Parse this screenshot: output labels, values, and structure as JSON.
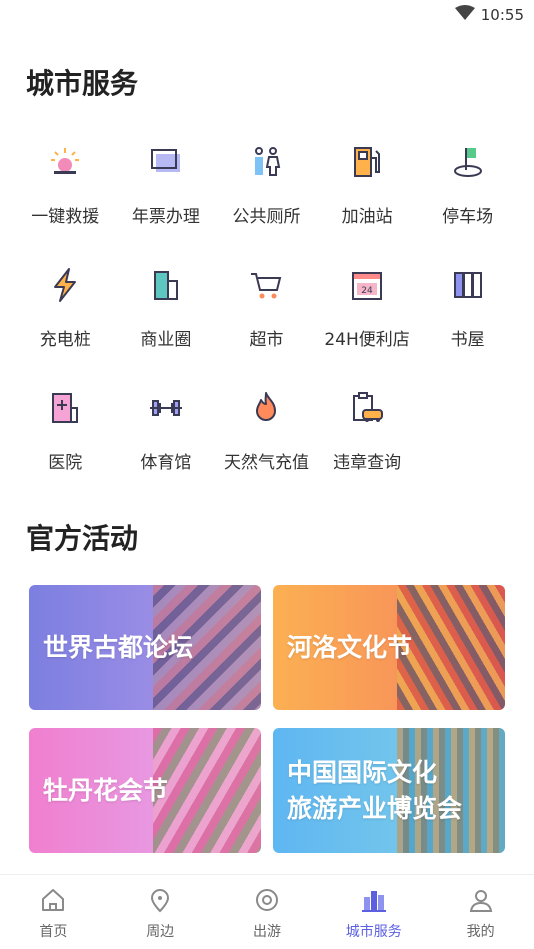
{
  "status_bar": {
    "time": "10:55"
  },
  "services": {
    "title": "城市服务",
    "items": [
      {
        "label": "一键救援",
        "icon": "siren-icon"
      },
      {
        "label": "年票办理",
        "icon": "ticket-card-icon"
      },
      {
        "label": "公共厕所",
        "icon": "restroom-icon"
      },
      {
        "label": "加油站",
        "icon": "fuel-pump-icon"
      },
      {
        "label": "停车场",
        "icon": "parking-icon"
      },
      {
        "label": "充电桩",
        "icon": "lightning-icon"
      },
      {
        "label": "商业圈",
        "icon": "building-icon"
      },
      {
        "label": "超市",
        "icon": "shopping-cart-icon"
      },
      {
        "label": "24H便利店",
        "icon": "store-24h-icon"
      },
      {
        "label": "书屋",
        "icon": "books-icon"
      },
      {
        "label": "医院",
        "icon": "hospital-icon"
      },
      {
        "label": "体育馆",
        "icon": "dumbbell-icon"
      },
      {
        "label": "天然气充值",
        "icon": "flame-icon"
      },
      {
        "label": "违章查询",
        "icon": "car-clipboard-icon"
      }
    ]
  },
  "activities": {
    "title": "官方活动",
    "cards": [
      {
        "title_line1": "世界古都论坛",
        "title_line2": ""
      },
      {
        "title_line1": "河洛文化节",
        "title_line2": ""
      },
      {
        "title_line1": "牡丹花会节",
        "title_line2": ""
      },
      {
        "title_line1": "中国国际文化",
        "title_line2": "旅游产业博览会"
      }
    ]
  },
  "tabbar": {
    "tabs": [
      {
        "label": "首页",
        "icon": "home-icon"
      },
      {
        "label": "周边",
        "icon": "location-pin-icon"
      },
      {
        "label": "出游",
        "icon": "travel-icon"
      },
      {
        "label": "城市服务",
        "icon": "city-buildings-icon"
      },
      {
        "label": "我的",
        "icon": "person-icon"
      }
    ],
    "active_index": 3
  },
  "colors": {
    "accent": "#5b5fe0",
    "icon_dark": "#3a3a55",
    "icon_pink": "#f28bb8",
    "icon_orange": "#ffb24a"
  }
}
